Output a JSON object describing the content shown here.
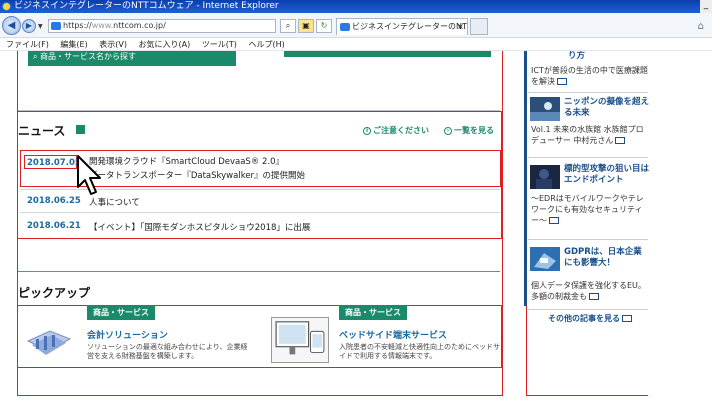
{
  "window": {
    "title": "ビジネスインテグレーターのNTTコムウェア - Internet Explorer"
  },
  "addressbar": {
    "url_scheme": "https://",
    "url_host_dim": "www.",
    "url_rest": "nttcom.co.jp/",
    "tab_title": "ビジネスインテグレーターのNTT...",
    "tab_close": "×"
  },
  "menu": {
    "items": [
      "ファイル(F)",
      "編集(E)",
      "表示(V)",
      "お気に入り(A)",
      "ツール(T)",
      "ヘルプ(H)"
    ]
  },
  "page": {
    "top_button": "商品・サービス名から探す",
    "news": {
      "heading": "ニュース",
      "notice_link": "ご注意ください",
      "all_link": "一覧を見る",
      "items": [
        {
          "date": "2018.07.05",
          "line1": "開発環境クラウド『SmartCloud DevaaS® 2.0』",
          "line2": "データトランスポーター『DataSkywalker』の提供開始"
        },
        {
          "date": "2018.06.25",
          "line1": "人事について"
        },
        {
          "date": "2018.06.21",
          "line1": "【イベント】「国際モダンホスピタルショウ2018」に出展"
        }
      ]
    },
    "pickup": {
      "heading": "ピックアップ",
      "cards": [
        {
          "badge": "商品・サービス",
          "title": "会計ソリューション",
          "desc": "ソリューションの最適な組み合わせにより、企業経営を支える財務基盤を構築します。"
        },
        {
          "badge": "商品・サービス",
          "title": "ベッドサイド端末サービス",
          "desc": "入院患者の不安軽減と快適性向上のためにベッドサイドで利用する情報端末です。"
        }
      ]
    },
    "sidebar": {
      "item0_tail": "り方",
      "item0_desc": "ICTが普段の生活の中で医療課題を解決",
      "item1_title": "ニッポンの擬像を超える未来",
      "item1_desc": "Vol.1 未来の水族館 水族館プロデューサー 中村元さん",
      "item2_title": "標的型攻撃の狙い目はエンドポイント",
      "item2_desc": "～EDRはモバイルワークやテレワークにも有効なセキュリティー～",
      "item3_title": "GDPRは、日本企業にも影響大！",
      "item3_desc": "個人データ保護を強化するEU。多額の制裁金も",
      "more": "その他の記事を見る"
    }
  },
  "colors": {
    "accent_green": "#1a8a6a",
    "link_blue": "#1a6aa0",
    "highlight_red": "#e02020"
  }
}
